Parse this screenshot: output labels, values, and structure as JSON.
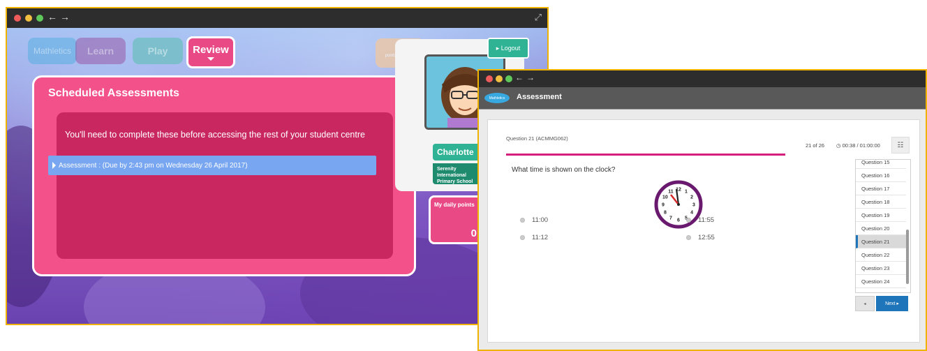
{
  "window1": {
    "nav": {
      "mathletics": "Mathletics",
      "learn": "Learn",
      "play": "Play",
      "review": "Review"
    },
    "points_week": {
      "value": "0",
      "label": "points this week"
    },
    "logout": "▸ Logout",
    "scheduled": {
      "title": "Scheduled Assessments",
      "message": "You'll need to complete these before accessing the rest of your student centre",
      "assessment": "Assessment : (Due by 2:43 pm on Wednesday 26 April 2017)"
    },
    "profile": {
      "name": "Charlotte",
      "school": "Serenity International Primary School"
    },
    "daily_points": {
      "label": "My daily points",
      "value": "0"
    }
  },
  "window2": {
    "logo": "Mathletics",
    "title": "Assessment",
    "question_id": "Question 21 (ACMMG062)",
    "count": "21 of 26",
    "timer": "◷ 00:38 / 01:00:00",
    "menu_icon": "☷",
    "question": "What time is shown on the clock?",
    "options": [
      "11:00",
      "11:55",
      "11:12",
      "12:55"
    ],
    "question_list": [
      "Question 15",
      "Question 16",
      "Question 17",
      "Question 18",
      "Question 19",
      "Question 20",
      "Question 21",
      "Question 22",
      "Question 23",
      "Question 24"
    ],
    "active_question": "Question 21",
    "prev": "◂",
    "next": "Next ▸",
    "clock_numbers": [
      "12",
      "1",
      "2",
      "3",
      "4",
      "5",
      "6",
      "7",
      "8",
      "9",
      "10",
      "11"
    ],
    "progress_percent": 80
  },
  "colors": {
    "pink": "#f2518a",
    "dark_pink": "#c9275f",
    "teal": "#2fb394",
    "blue": "#1f75b9",
    "frame": "#f0b400"
  }
}
